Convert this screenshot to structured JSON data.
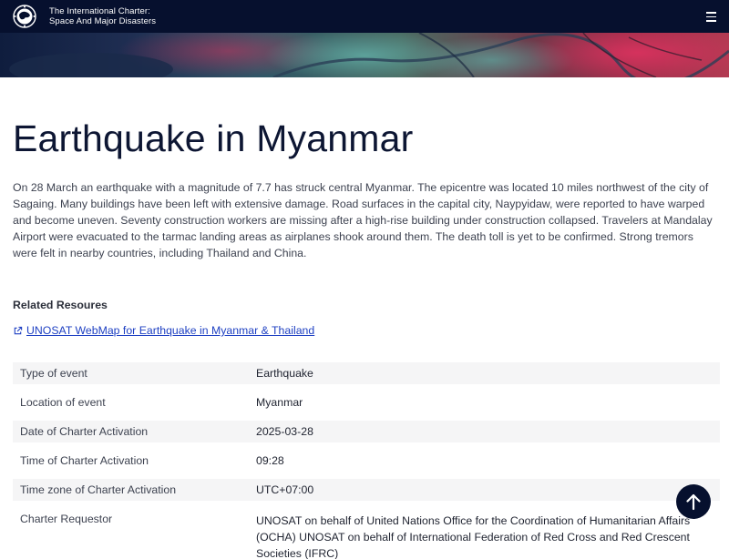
{
  "header": {
    "brand_line1": "The International Charter:",
    "brand_line2": "Space And Major Disasters",
    "logo_icon": "charter-globe-logo-icon",
    "menu_icon": "hamburger-menu-icon",
    "background_color": "#06102e"
  },
  "banner": {
    "image": "satellite-imagery-banner"
  },
  "page": {
    "title": "Earthquake in Myanmar",
    "description": "On 28 March an earthquake with a magnitude of 7.7 has struck central Myanmar. The epicentre was located 10 miles northwest of the city of Sagaing. Many buildings have been left with extensive damage. Road surfaces in the capital city, Naypyidaw, were reported to have warped and become uneven. Seventy construction workers are missing after a high-rise building under construction collapsed. Travelers at Mandalay Airport were evacuated to the tarmac landing areas as airplanes shook around them. The death toll is yet to be confirmed. Strong tremors were felt in nearby countries, including Thailand and China."
  },
  "related": {
    "heading": "Related Resoures",
    "link_label": "UNOSAT WebMap for Earthquake in Myanmar & Thailand",
    "link_icon": "external-link-icon",
    "link_color": "#1d3fc2"
  },
  "details": [
    {
      "label": "Type of event",
      "value": "Earthquake"
    },
    {
      "label": "Location of event",
      "value": "Myanmar"
    },
    {
      "label": "Date of Charter Activation",
      "value": "2025-03-28"
    },
    {
      "label": "Time of Charter Activation",
      "value": "09:28"
    },
    {
      "label": "Time zone of Charter Activation",
      "value": "UTC+07:00"
    },
    {
      "label": "Charter Requestor",
      "value": "UNOSAT on behalf of United Nations Office for the Coordination of Humanitarian Affairs (OCHA) UNOSAT on behalf of International Federation of Red Cross and Red Crescent Societies (IFRC)"
    }
  ],
  "scroll_top": {
    "icon": "arrow-up-icon"
  }
}
